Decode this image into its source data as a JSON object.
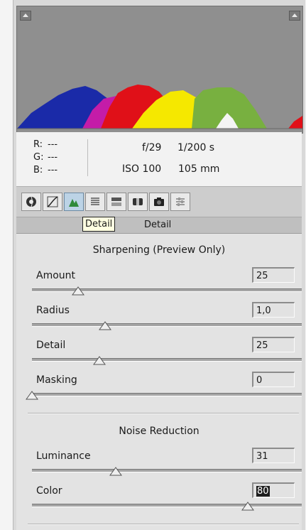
{
  "histogram": {
    "channels": [
      "blue",
      "magenta",
      "red",
      "yellow",
      "green",
      "red-right"
    ],
    "colors": {
      "bg": "#8f8f8f",
      "blue": "#1a2aa8",
      "magenta": "#c41ca8",
      "red": "#e01018",
      "yellow": "#f5e800",
      "green": "#78b040",
      "white": "#f4f4f4"
    }
  },
  "info": {
    "r_label": "R:",
    "r_value": "---",
    "g_label": "G:",
    "g_value": "---",
    "b_label": "B:",
    "b_value": "---",
    "aperture": "f/29",
    "shutter": "1/200 s",
    "iso": "ISO 100",
    "focal": "105 mm"
  },
  "toolbar": {
    "tools": [
      "basic-icon",
      "tone-curve-icon",
      "detail-icon",
      "hsl-icon",
      "split-toning-icon",
      "lens-corrections-icon",
      "camera-calibration-icon",
      "presets-icon"
    ],
    "active": "detail-icon"
  },
  "tabbar": {
    "title": "Detail"
  },
  "tooltip": {
    "text": "Detail"
  },
  "sharpening": {
    "title": "Sharpening (Preview Only)",
    "sliders": [
      {
        "label": "Amount",
        "value": "25",
        "level": 0.17
      },
      {
        "label": "Radius",
        "value": "1,0",
        "level": 0.27
      },
      {
        "label": "Detail",
        "value": "25",
        "level": 0.25
      },
      {
        "label": "Masking",
        "value": "0",
        "level": 0.0
      }
    ]
  },
  "noise": {
    "title": "Noise Reduction",
    "sliders": [
      {
        "label": "Luminance",
        "value": "31",
        "level": 0.31
      },
      {
        "label": "Color",
        "value": "80",
        "level": 0.8
      }
    ]
  }
}
